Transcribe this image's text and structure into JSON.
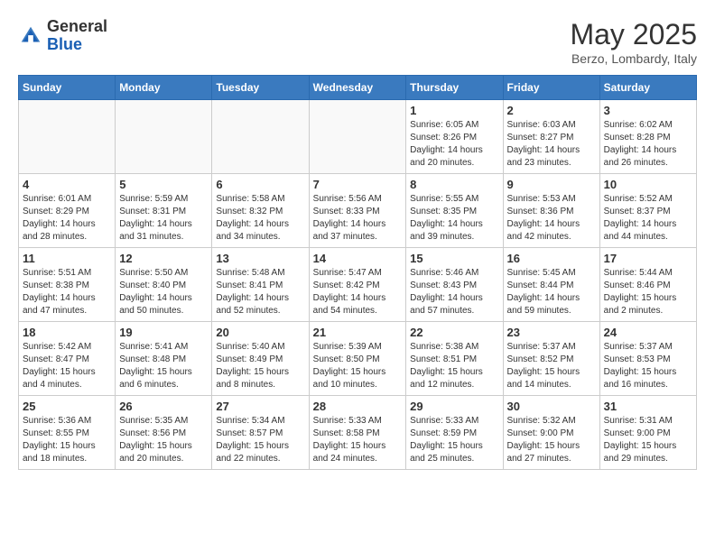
{
  "header": {
    "logo_line1": "General",
    "logo_line2": "Blue",
    "month": "May 2025",
    "location": "Berzo, Lombardy, Italy"
  },
  "weekdays": [
    "Sunday",
    "Monday",
    "Tuesday",
    "Wednesday",
    "Thursday",
    "Friday",
    "Saturday"
  ],
  "weeks": [
    [
      {
        "day": "",
        "info": ""
      },
      {
        "day": "",
        "info": ""
      },
      {
        "day": "",
        "info": ""
      },
      {
        "day": "",
        "info": ""
      },
      {
        "day": "1",
        "info": "Sunrise: 6:05 AM\nSunset: 8:26 PM\nDaylight: 14 hours\nand 20 minutes."
      },
      {
        "day": "2",
        "info": "Sunrise: 6:03 AM\nSunset: 8:27 PM\nDaylight: 14 hours\nand 23 minutes."
      },
      {
        "day": "3",
        "info": "Sunrise: 6:02 AM\nSunset: 8:28 PM\nDaylight: 14 hours\nand 26 minutes."
      }
    ],
    [
      {
        "day": "4",
        "info": "Sunrise: 6:01 AM\nSunset: 8:29 PM\nDaylight: 14 hours\nand 28 minutes."
      },
      {
        "day": "5",
        "info": "Sunrise: 5:59 AM\nSunset: 8:31 PM\nDaylight: 14 hours\nand 31 minutes."
      },
      {
        "day": "6",
        "info": "Sunrise: 5:58 AM\nSunset: 8:32 PM\nDaylight: 14 hours\nand 34 minutes."
      },
      {
        "day": "7",
        "info": "Sunrise: 5:56 AM\nSunset: 8:33 PM\nDaylight: 14 hours\nand 37 minutes."
      },
      {
        "day": "8",
        "info": "Sunrise: 5:55 AM\nSunset: 8:35 PM\nDaylight: 14 hours\nand 39 minutes."
      },
      {
        "day": "9",
        "info": "Sunrise: 5:53 AM\nSunset: 8:36 PM\nDaylight: 14 hours\nand 42 minutes."
      },
      {
        "day": "10",
        "info": "Sunrise: 5:52 AM\nSunset: 8:37 PM\nDaylight: 14 hours\nand 44 minutes."
      }
    ],
    [
      {
        "day": "11",
        "info": "Sunrise: 5:51 AM\nSunset: 8:38 PM\nDaylight: 14 hours\nand 47 minutes."
      },
      {
        "day": "12",
        "info": "Sunrise: 5:50 AM\nSunset: 8:40 PM\nDaylight: 14 hours\nand 50 minutes."
      },
      {
        "day": "13",
        "info": "Sunrise: 5:48 AM\nSunset: 8:41 PM\nDaylight: 14 hours\nand 52 minutes."
      },
      {
        "day": "14",
        "info": "Sunrise: 5:47 AM\nSunset: 8:42 PM\nDaylight: 14 hours\nand 54 minutes."
      },
      {
        "day": "15",
        "info": "Sunrise: 5:46 AM\nSunset: 8:43 PM\nDaylight: 14 hours\nand 57 minutes."
      },
      {
        "day": "16",
        "info": "Sunrise: 5:45 AM\nSunset: 8:44 PM\nDaylight: 14 hours\nand 59 minutes."
      },
      {
        "day": "17",
        "info": "Sunrise: 5:44 AM\nSunset: 8:46 PM\nDaylight: 15 hours\nand 2 minutes."
      }
    ],
    [
      {
        "day": "18",
        "info": "Sunrise: 5:42 AM\nSunset: 8:47 PM\nDaylight: 15 hours\nand 4 minutes."
      },
      {
        "day": "19",
        "info": "Sunrise: 5:41 AM\nSunset: 8:48 PM\nDaylight: 15 hours\nand 6 minutes."
      },
      {
        "day": "20",
        "info": "Sunrise: 5:40 AM\nSunset: 8:49 PM\nDaylight: 15 hours\nand 8 minutes."
      },
      {
        "day": "21",
        "info": "Sunrise: 5:39 AM\nSunset: 8:50 PM\nDaylight: 15 hours\nand 10 minutes."
      },
      {
        "day": "22",
        "info": "Sunrise: 5:38 AM\nSunset: 8:51 PM\nDaylight: 15 hours\nand 12 minutes."
      },
      {
        "day": "23",
        "info": "Sunrise: 5:37 AM\nSunset: 8:52 PM\nDaylight: 15 hours\nand 14 minutes."
      },
      {
        "day": "24",
        "info": "Sunrise: 5:37 AM\nSunset: 8:53 PM\nDaylight: 15 hours\nand 16 minutes."
      }
    ],
    [
      {
        "day": "25",
        "info": "Sunrise: 5:36 AM\nSunset: 8:55 PM\nDaylight: 15 hours\nand 18 minutes."
      },
      {
        "day": "26",
        "info": "Sunrise: 5:35 AM\nSunset: 8:56 PM\nDaylight: 15 hours\nand 20 minutes."
      },
      {
        "day": "27",
        "info": "Sunrise: 5:34 AM\nSunset: 8:57 PM\nDaylight: 15 hours\nand 22 minutes."
      },
      {
        "day": "28",
        "info": "Sunrise: 5:33 AM\nSunset: 8:58 PM\nDaylight: 15 hours\nand 24 minutes."
      },
      {
        "day": "29",
        "info": "Sunrise: 5:33 AM\nSunset: 8:59 PM\nDaylight: 15 hours\nand 25 minutes."
      },
      {
        "day": "30",
        "info": "Sunrise: 5:32 AM\nSunset: 9:00 PM\nDaylight: 15 hours\nand 27 minutes."
      },
      {
        "day": "31",
        "info": "Sunrise: 5:31 AM\nSunset: 9:00 PM\nDaylight: 15 hours\nand 29 minutes."
      }
    ]
  ]
}
